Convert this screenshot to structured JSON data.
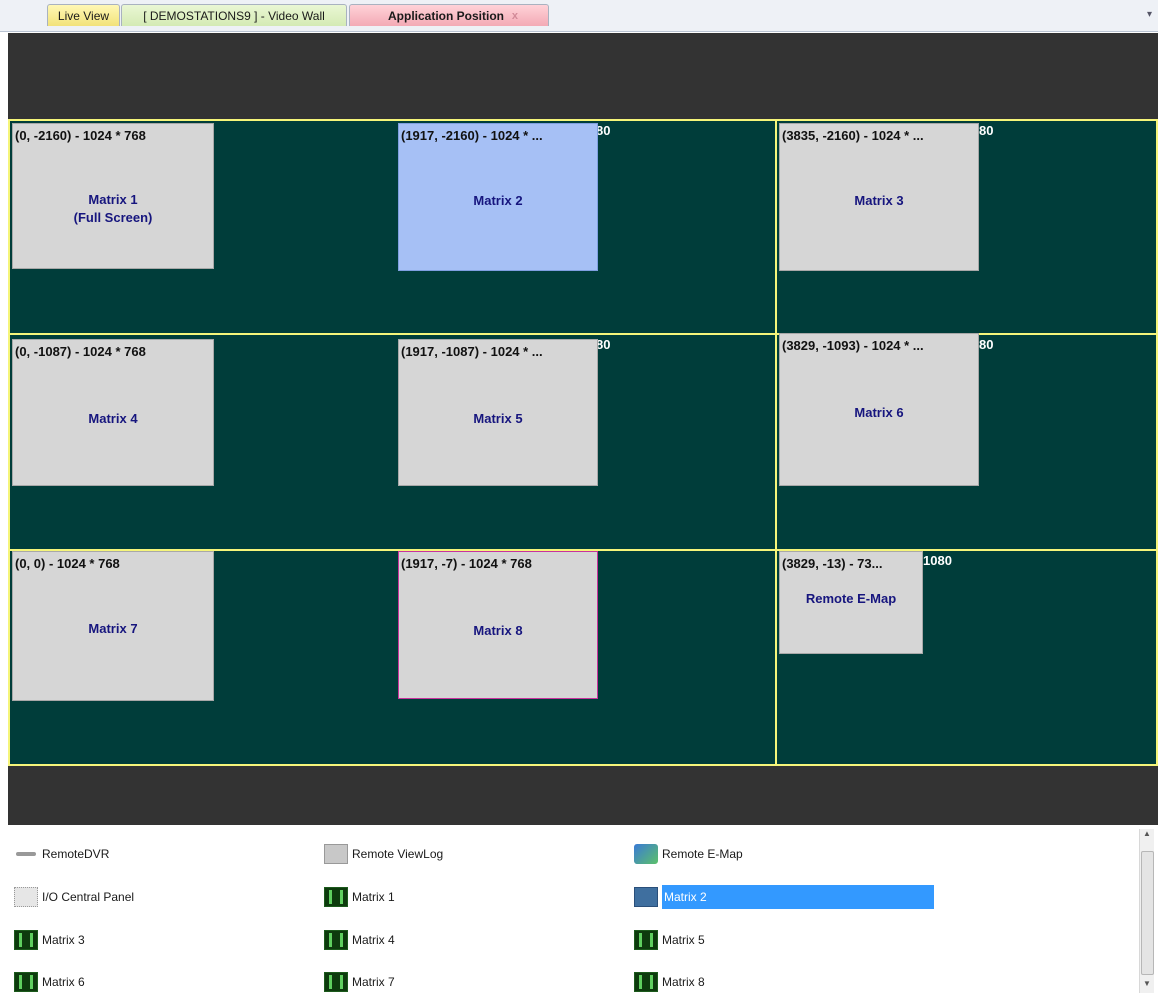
{
  "tabs": [
    {
      "label": "Live View"
    },
    {
      "label": "[ DEMOSTATIONS9 ] - Video Wall"
    },
    {
      "label": "Application Position"
    }
  ],
  "tab_close_glyph": "x",
  "dropdown_glyph": "▾",
  "monitor_resolution_label": "80",
  "monitor_resolution_label_full": "1080",
  "windows": [
    {
      "position": "(0, -2160) - 1024 * 768",
      "title_line1": "Matrix 1",
      "title_line2": "(Full Screen)"
    },
    {
      "position": "(1917, -2160) - 1024 * ...",
      "title": "Matrix 2"
    },
    {
      "position": "(3835, -2160) - 1024 * ...",
      "title": "Matrix 3"
    },
    {
      "position": "(0, -1087) - 1024 * 768",
      "title": "Matrix 4"
    },
    {
      "position": "(1917, -1087) - 1024 * ...",
      "title": "Matrix 5"
    },
    {
      "position": "(3829, -1093) - 1024 * ...",
      "title": "Matrix 6"
    },
    {
      "position": "(0, 0) - 1024 * 768",
      "title": "Matrix 7"
    },
    {
      "position": "(1917, -7) - 1024 * 768",
      "title": "Matrix 8"
    },
    {
      "position": "(3829, -13) - 73...",
      "title": "Remote E-Map"
    }
  ],
  "apps": [
    {
      "label": "RemoteDVR",
      "icon": "dvr-icon"
    },
    {
      "label": "Remote ViewLog",
      "icon": "viewlog-icon"
    },
    {
      "label": "Remote E-Map",
      "icon": "emap-icon"
    },
    {
      "label": "I/O Central Panel",
      "icon": "io-panel-icon"
    },
    {
      "label": "Matrix 1",
      "icon": "matrix-icon"
    },
    {
      "label": "Matrix 2",
      "icon": "matrix-icon",
      "selected": true
    },
    {
      "label": "Matrix 3",
      "icon": "matrix-icon"
    },
    {
      "label": "Matrix 4",
      "icon": "matrix-icon"
    },
    {
      "label": "Matrix 5",
      "icon": "matrix-icon"
    },
    {
      "label": "Matrix 6",
      "icon": "matrix-icon"
    },
    {
      "label": "Matrix 7",
      "icon": "matrix-icon"
    },
    {
      "label": "Matrix 8",
      "icon": "matrix-icon"
    }
  ],
  "scrollbar": {
    "up": "▲",
    "down": "▼"
  },
  "colors": {
    "wall_bg": "#333333",
    "monitor_bg": "#003d3a",
    "monitor_border": "#f5f57a",
    "window_bg": "#d6d6d6",
    "window_selected_bg": "#a6c0f5",
    "window_title": "#16157e",
    "list_selection": "#3399ff"
  }
}
